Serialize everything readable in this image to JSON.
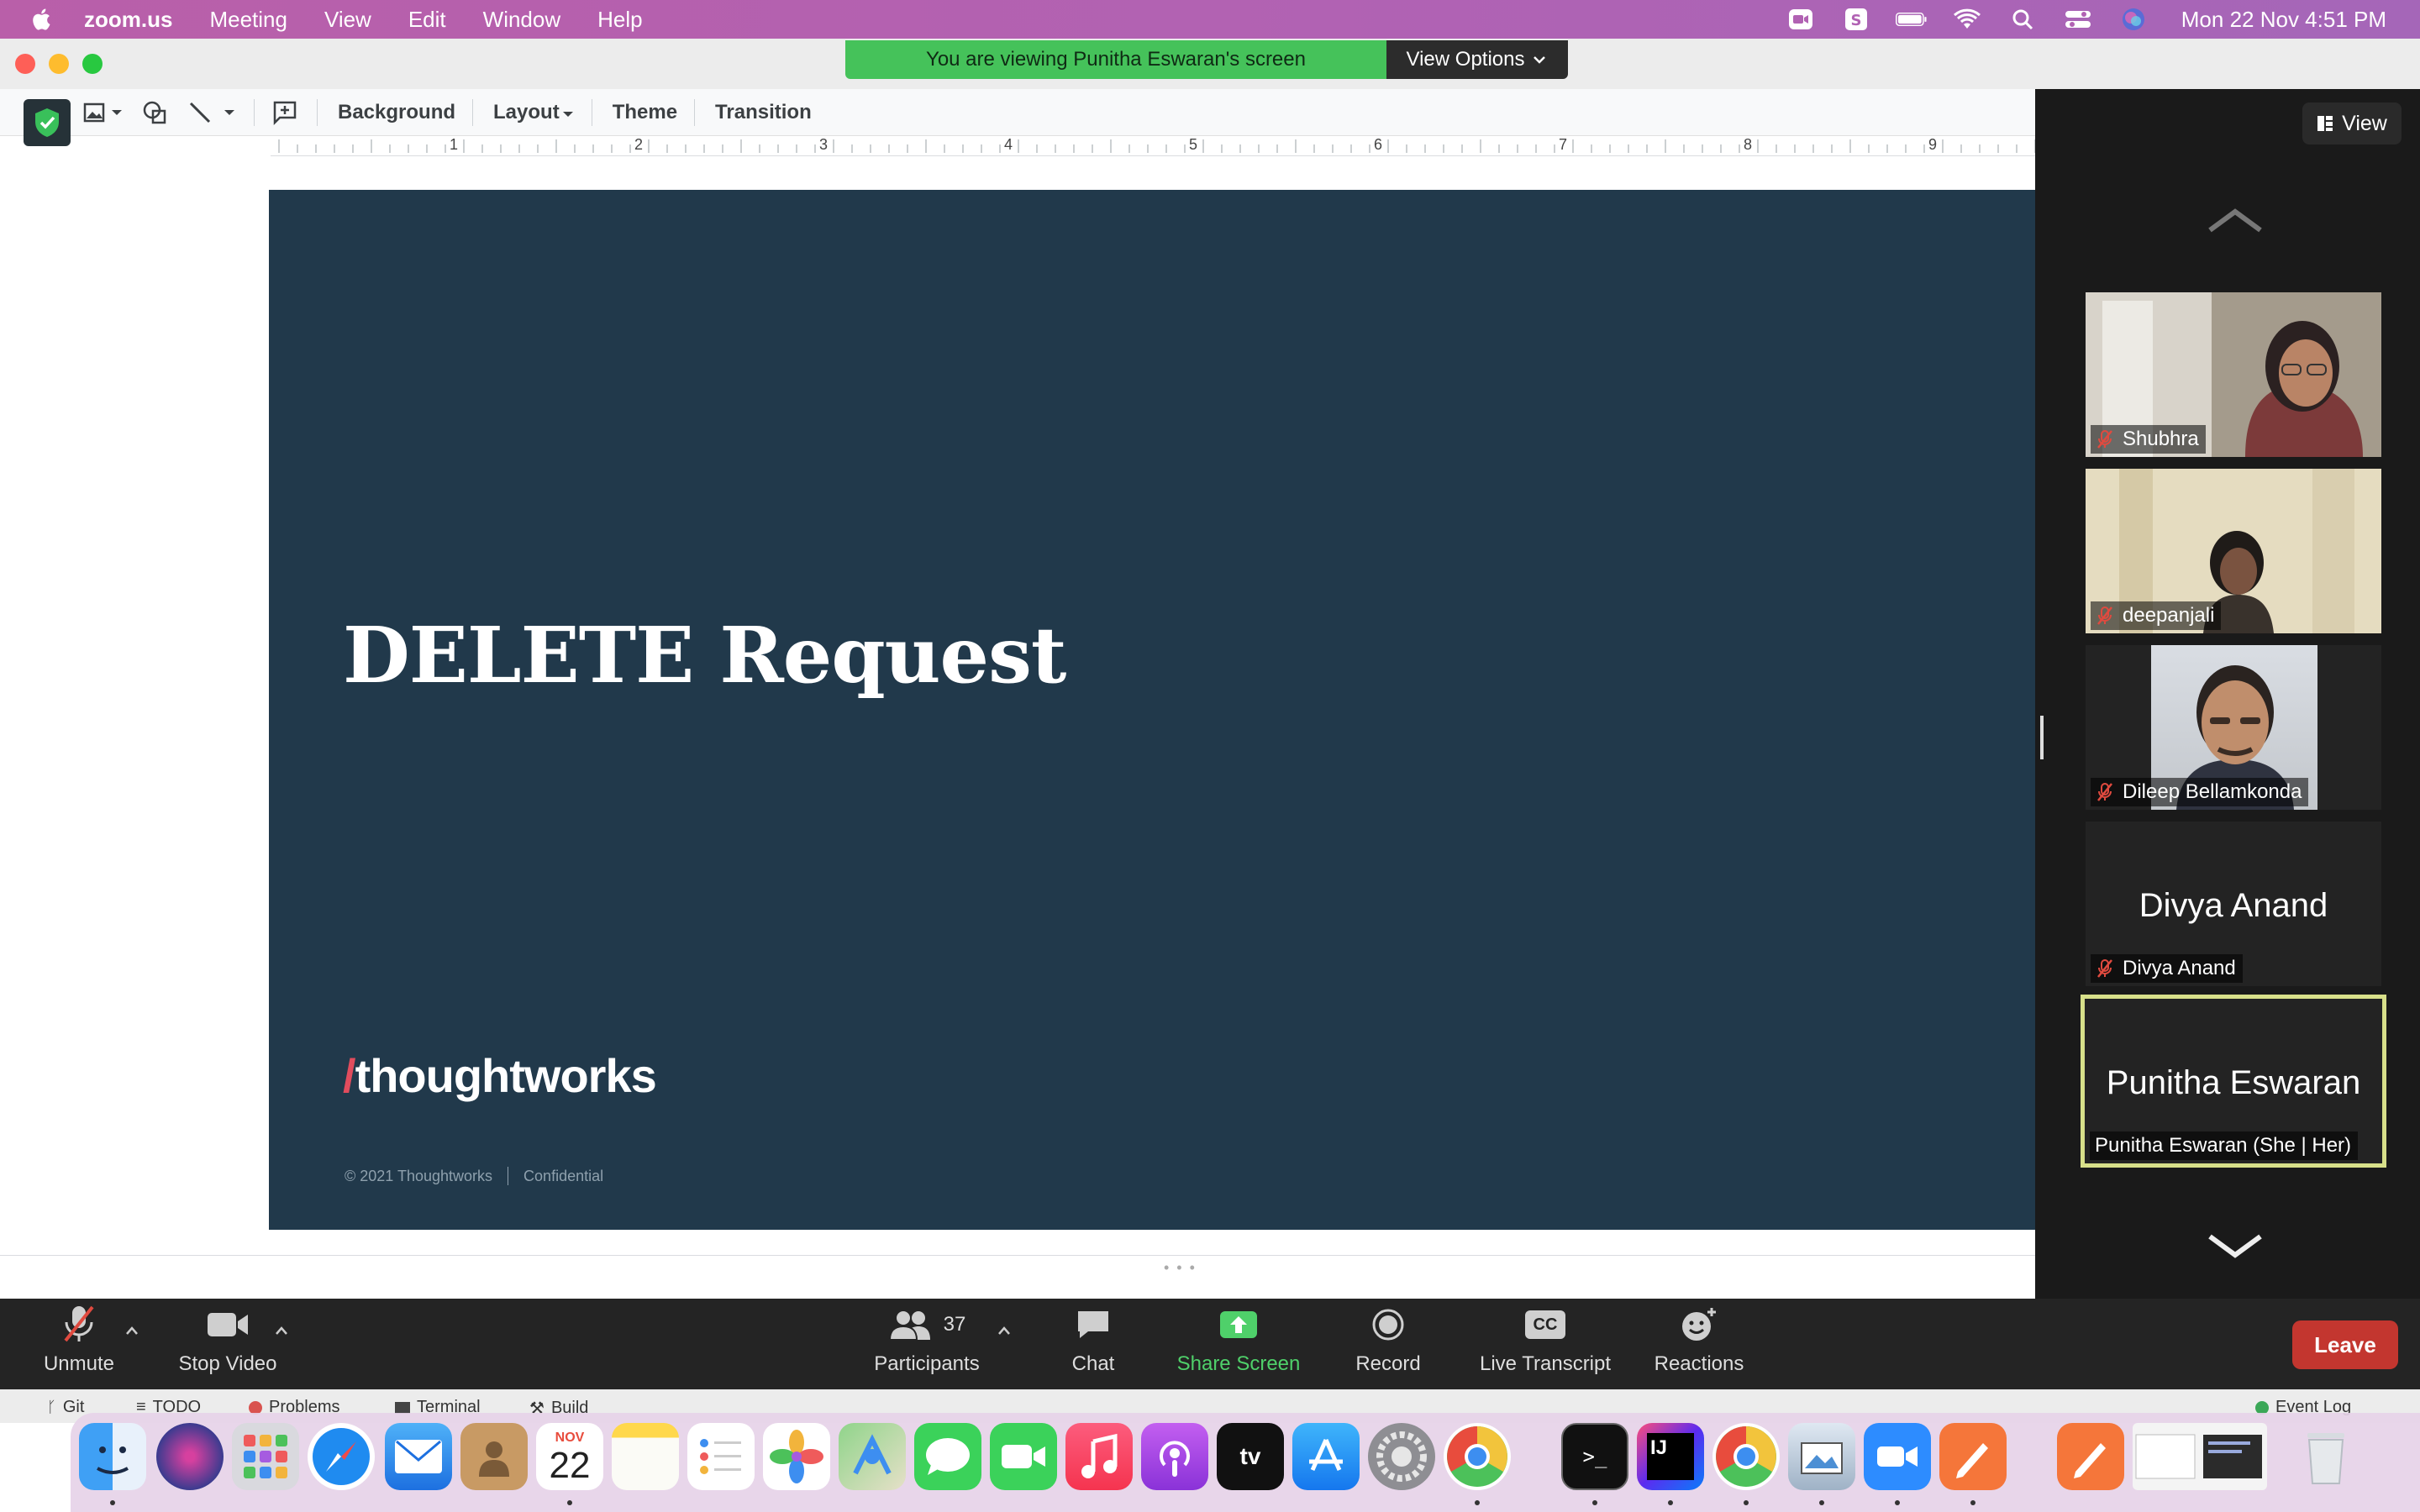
{
  "menubar": {
    "app": "zoom.us",
    "items": [
      "Meeting",
      "View",
      "Edit",
      "Window",
      "Help"
    ],
    "datetime": "Mon 22 Nov  4:51 PM"
  },
  "share_banner": {
    "message": "You are viewing Punitha Eswaran's screen",
    "options": "View Options"
  },
  "slides_toolbar": {
    "background": "Background",
    "layout": "Layout",
    "theme": "Theme",
    "transition": "Transition"
  },
  "ruler": [
    "1",
    "2",
    "3",
    "4",
    "5",
    "6",
    "7",
    "8",
    "9"
  ],
  "slide": {
    "title": "DELETE Request",
    "logo_slash": "/",
    "logo": "thoughtworks",
    "copyright": "© 2021 Thoughtworks",
    "confidential": "Confidential",
    "background_color": "#21394b"
  },
  "gallery": {
    "view_label": "View",
    "participants": [
      {
        "name": "Shubhra",
        "muted": true
      },
      {
        "name": "deepanjali",
        "muted": true
      },
      {
        "name": "Dileep Bellamkonda",
        "muted": true
      },
      {
        "name": "Divya Anand",
        "display": "Divya Anand",
        "muted": true
      },
      {
        "name": "Punitha Eswaran  (She | Her)",
        "display": "Punitha Eswaran",
        "muted": false,
        "active_speaker": true
      }
    ]
  },
  "controls": {
    "unmute": "Unmute",
    "stop_video": "Stop Video",
    "participants": "Participants",
    "participant_count": "37",
    "chat": "Chat",
    "share_screen": "Share Screen",
    "record": "Record",
    "live_transcript": "Live Transcript",
    "cc": "CC",
    "reactions": "Reactions",
    "leave": "Leave",
    "leave_color": "#c3362f",
    "share_color": "#4fd06a"
  },
  "ide_strip": {
    "git": "Git",
    "todo": "TODO",
    "problems": "Problems",
    "terminal": "Terminal",
    "build": "Build",
    "event_log": "Event Log"
  },
  "dock": {
    "calendar_month": "NOV",
    "calendar_day": "22",
    "apps": [
      "finder-icon",
      "siri-icon",
      "launchpad-icon",
      "safari-icon",
      "mail-icon",
      "contacts-icon",
      "calendar-icon",
      "notes-icon",
      "reminders-icon",
      "photos-icon",
      "maps-icon",
      "messages-icon",
      "facetime-icon",
      "music-icon",
      "podcasts-icon",
      "appletv-icon",
      "appstore-icon",
      "settings-icon",
      "chrome-icon",
      "terminal-icon",
      "intellij-icon",
      "chrome-icon",
      "preview-icon",
      "zoom-icon",
      "pen-icon",
      "pen-icon",
      "trash-icon"
    ]
  }
}
